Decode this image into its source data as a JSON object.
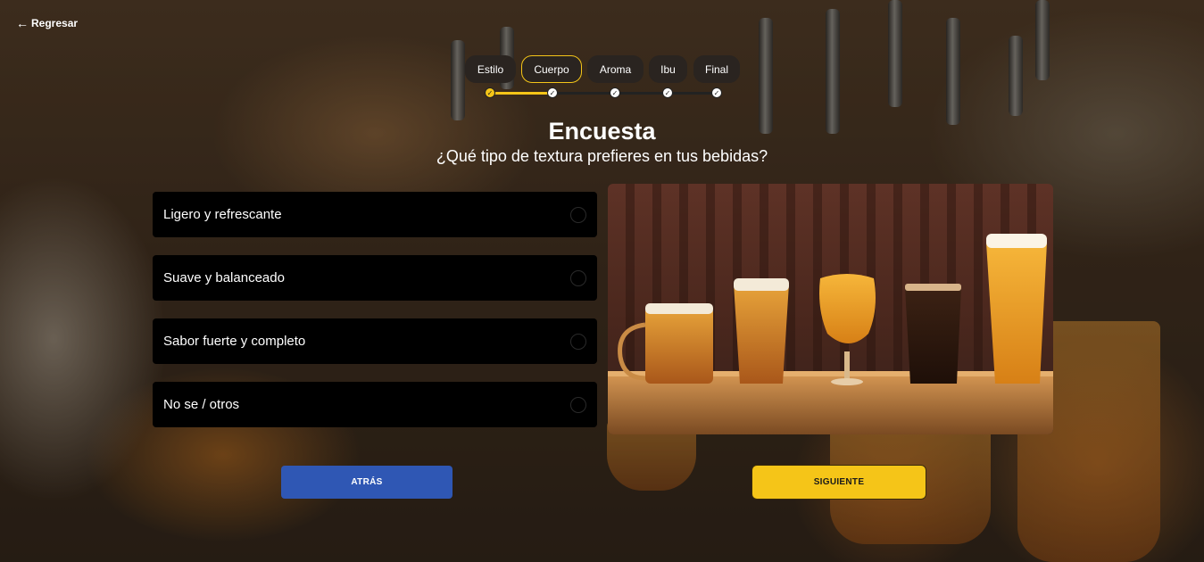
{
  "back_link": {
    "label": "Regresar",
    "arrow": "←"
  },
  "stepper": {
    "steps": [
      {
        "label": "Estilo",
        "state": "done"
      },
      {
        "label": "Cuerpo",
        "state": "current"
      },
      {
        "label": "Aroma",
        "state": "pending"
      },
      {
        "label": "Ibu",
        "state": "pending"
      },
      {
        "label": "Final",
        "state": "pending"
      }
    ],
    "check_glyph": "✓"
  },
  "survey": {
    "title": "Encuesta",
    "question": "¿Qué tipo de textura prefieres en tus bebidas?",
    "options": [
      {
        "label": "Ligero y refrescante",
        "selected": false
      },
      {
        "label": "Suave y balanceado",
        "selected": false
      },
      {
        "label": "Sabor fuerte y completo",
        "selected": false
      },
      {
        "label": "No se / otros",
        "selected": false
      }
    ]
  },
  "buttons": {
    "back_label": "ATRÁS",
    "next_label": "SIGUIENTE"
  },
  "colors": {
    "accent": "#f5c518",
    "back_button": "#2f57b4",
    "option_bg": "#000000"
  },
  "icons": [
    "arrow-left-icon",
    "check-icon",
    "radio-icon",
    "beer-glasses-image"
  ]
}
